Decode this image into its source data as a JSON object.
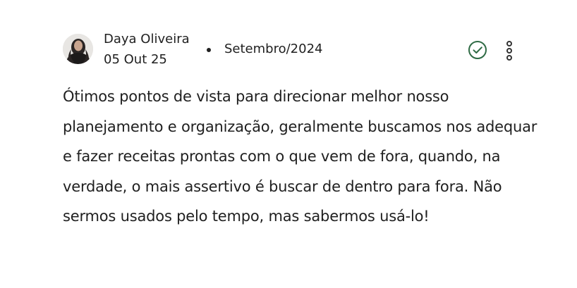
{
  "comment_card": {
    "author": {
      "name": "Daya Oliveira",
      "date": "05 Out 25",
      "avatar_icon": "avatar-photo"
    },
    "separator": "•",
    "period": "Setembro/2024",
    "actions": {
      "verified_icon": "check-circle-icon",
      "more_icon": "more-vertical-icon"
    },
    "comment_text": "Ótimos pontos de vista para direcionar melhor nosso planejamento e organização, geralmente buscamos nos adequar e fazer receitas prontas com o que vem de fora, quando, na verdade, o mais assertivo é buscar de dentro para fora. Não sermos usados pelo tempo, mas sabermos usá-lo!"
  },
  "colors": {
    "accent_green": "#2f6b45",
    "text": "#1f1f1f"
  }
}
